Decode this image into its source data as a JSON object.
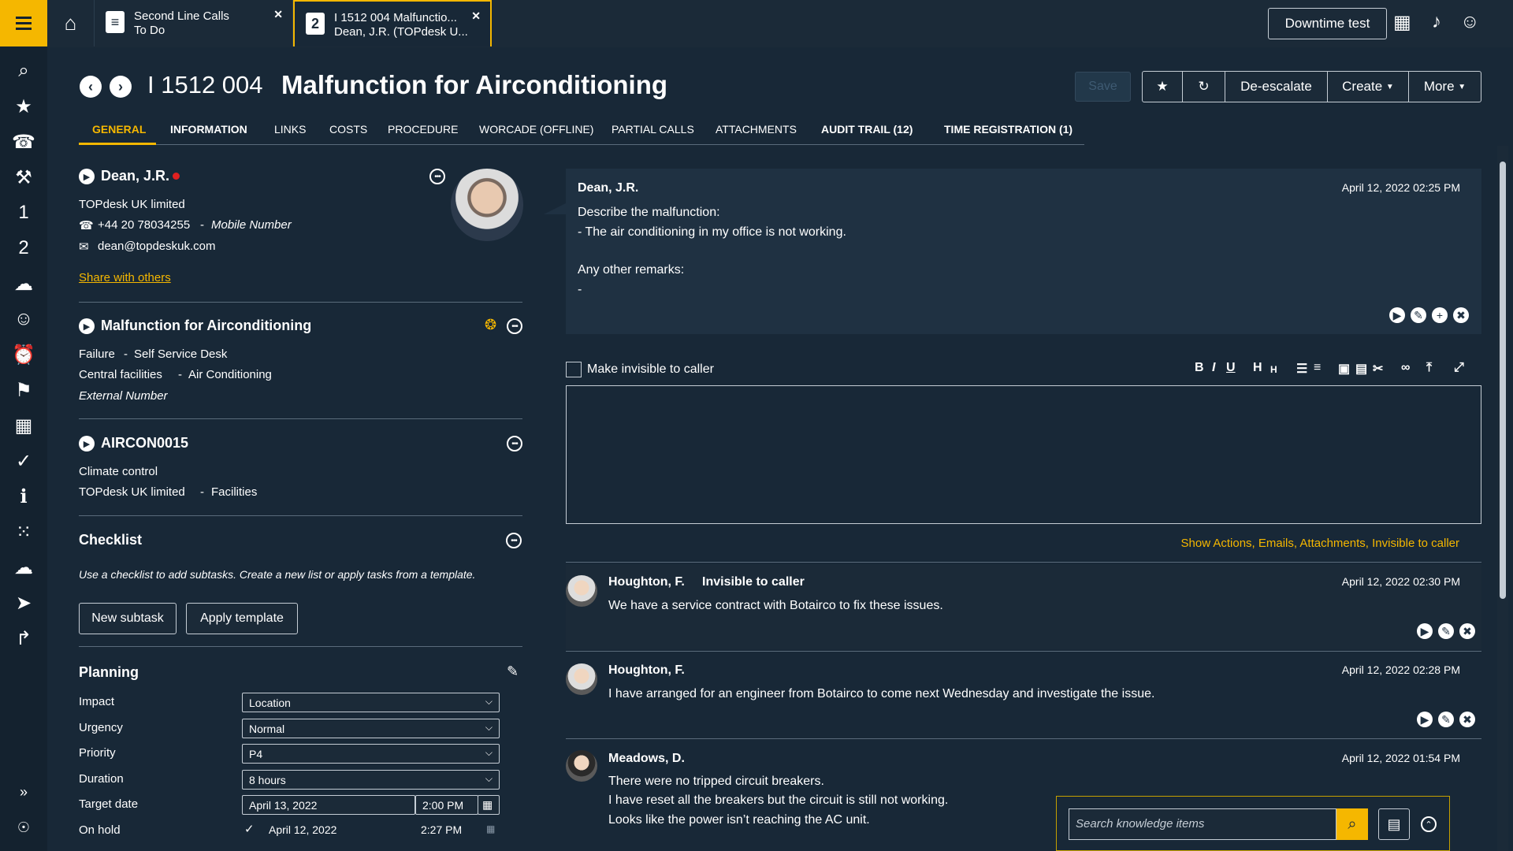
{
  "app": {
    "brand_color": "#f5b700",
    "bg": "#182837"
  },
  "topbar": {
    "tabs": [
      {
        "line1": "Second Line Calls",
        "line2": "To Do"
      },
      {
        "line1": "I 1512 004 Malfunctio...",
        "line2": "Dean, J.R. (TOPdesk U..."
      }
    ],
    "downtime_button": "Downtime test"
  },
  "call": {
    "number": "I 1512 004",
    "title": "Malfunction for Airconditioning",
    "save": "Save"
  },
  "header_buttons": {
    "deescalate": "De-escalate",
    "create": "Create",
    "more": "More"
  },
  "tabs": [
    "GENERAL",
    "INFORMATION",
    "LINKS",
    "COSTS",
    "PROCEDURE",
    "WORCADE (OFFLINE)",
    "PARTIAL CALLS",
    "ATTACHMENTS",
    "AUDIT TRAIL (12)",
    "TIME REGISTRATION (1)"
  ],
  "caller": {
    "name": "Dean, J.R.",
    "company": "TOPdesk UK limited",
    "phone": "+44 20 78034255",
    "phone_type": "Mobile Number",
    "email": "dean@topdeskuk.com",
    "share": "Share with others"
  },
  "request": {
    "title": "Malfunction for Airconditioning",
    "category": "Failure",
    "via": "Self Service Desk",
    "subcategory": "Central facilities",
    "subcategory2": "Air Conditioning",
    "external": "External Number"
  },
  "object": {
    "id": "AIRCON0015",
    "type": "Climate control",
    "owner": "TOPdesk UK limited",
    "dept": "Facilities"
  },
  "checklist": {
    "title": "Checklist",
    "hint": "Use a checklist to add subtasks. Create a new list or apply tasks from a template.",
    "new_subtask": "New subtask",
    "apply_template": "Apply template"
  },
  "planning": {
    "title": "Planning",
    "fields": [
      {
        "label": "Impact",
        "value": "Location"
      },
      {
        "label": "Urgency",
        "value": "Normal"
      },
      {
        "label": "Priority",
        "value": "P4"
      },
      {
        "label": "Duration",
        "value": "8 hours"
      }
    ],
    "target_label": "Target date",
    "target_date": "April 13, 2022",
    "target_time": "2:00 PM",
    "onhold_label": "On hold",
    "onhold_date": "April 12, 2022",
    "onhold_time": "2:27 PM"
  },
  "request_card": {
    "author": "Dean, J.R.",
    "time": "April 12, 2022 02:25 PM",
    "l1": "Describe the malfunction:",
    "l2": "- The air conditioning in my office is not working.",
    "l3": "Any other remarks:",
    "l4": "-"
  },
  "editor": {
    "invisible_label": "Make invisible to caller",
    "show_actions": "Show Actions, Emails, Attachments, Invisible to caller"
  },
  "messages": [
    {
      "author": "Houghton, F.",
      "flag": "Invisible to caller",
      "time": "April 12, 2022 02:30 PM",
      "lines": [
        "We have a service contract with Botairco to fix these issues."
      ]
    },
    {
      "author": "Houghton, F.",
      "flag": "",
      "time": "April 12, 2022 02:28 PM",
      "lines": [
        "I have arranged for an engineer from Botairco to come next Wednesday and investigate the issue."
      ]
    },
    {
      "author": "Meadows, D.",
      "flag": "",
      "time": "April 12, 2022 01:54 PM",
      "lines": [
        "There were no tripped circuit breakers.",
        "I have reset all the breakers but the circuit is still not working.",
        "Looks like the power isn’t reaching the AC unit."
      ]
    }
  ],
  "knowledge": {
    "placeholder": "Search knowledge items"
  }
}
